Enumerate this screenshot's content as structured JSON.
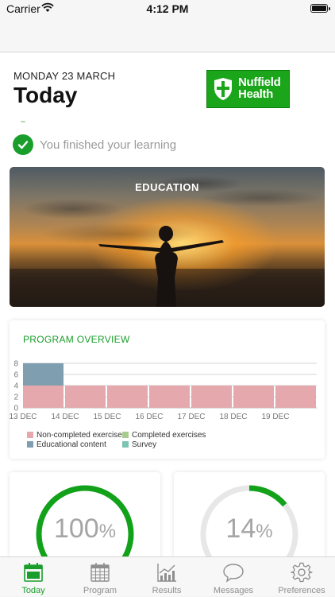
{
  "status_bar": {
    "carrier": "Carrier",
    "time": "4:12 PM"
  },
  "header": {
    "date": "MONDAY 23 MARCH",
    "title": "Today"
  },
  "logo": {
    "line1": "Nuffield",
    "line2": "Health",
    "color": "#1aa51a"
  },
  "learning_status": {
    "text": "You finished your learning",
    "icon": "check-circle-icon"
  },
  "education_card": {
    "label": "EDUCATION"
  },
  "program_overview": {
    "title": "PROGRAM OVERVIEW",
    "legend": [
      "Non-completed exercises",
      "Completed exercises",
      "Educational content",
      "Survey"
    ]
  },
  "chart_data": {
    "type": "bar",
    "stacked": true,
    "categories": [
      "13 DEC",
      "14 DEC",
      "15 DEC",
      "16 DEC",
      "17 DEC",
      "18 DEC",
      "19 DEC",
      ""
    ],
    "ylim": [
      0,
      8
    ],
    "yticks": [
      0,
      2,
      4,
      6,
      8
    ],
    "grid": true,
    "legend_position": "bottom",
    "series": [
      {
        "name": "Non-completed exercises",
        "color": "#e4a8ad",
        "values": [
          4,
          4,
          4,
          4,
          4,
          4,
          4,
          4
        ]
      },
      {
        "name": "Completed exercises",
        "color": "#a8cc90",
        "values": [
          0,
          0,
          0,
          0,
          0,
          0,
          0,
          0
        ]
      },
      {
        "name": "Educational content",
        "color": "#7f9fb0",
        "values": [
          4,
          0,
          0,
          0,
          0,
          0,
          0,
          0
        ]
      },
      {
        "name": "Survey",
        "color": "#7cc5b4",
        "values": [
          0,
          0,
          0,
          0,
          0,
          0,
          0,
          0
        ]
      }
    ]
  },
  "stats": [
    {
      "value": "100",
      "unit": "%",
      "progress": 1.0,
      "color": "#12a21a"
    },
    {
      "value": "14",
      "unit": "%",
      "progress": 0.14,
      "color": "#12a21a"
    }
  ],
  "tabs": [
    {
      "label": "Today",
      "icon": "calendar-today-icon",
      "active": true
    },
    {
      "label": "Program",
      "icon": "calendar-grid-icon",
      "active": false
    },
    {
      "label": "Results",
      "icon": "chart-icon",
      "active": false
    },
    {
      "label": "Messages",
      "icon": "speech-bubble-icon",
      "active": false
    },
    {
      "label": "Preferences",
      "icon": "gear-icon",
      "active": false
    }
  ],
  "colors": {
    "accent": "#1a9e2b",
    "muted_text": "#9a9a9a"
  }
}
